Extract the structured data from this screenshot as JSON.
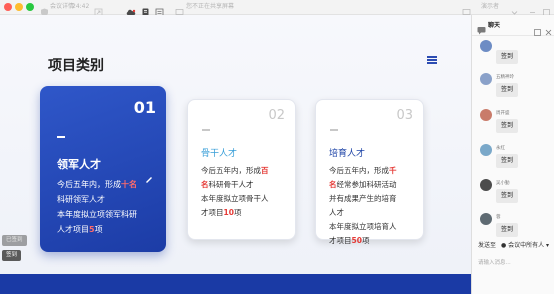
{
  "window": {
    "meeting_id": "会议详情",
    "timer": "24:42",
    "share_text": "您不正在共享屏幕",
    "top_right_text": "演示者",
    "colors": {
      "close": "#ff5f57",
      "minimize": "#febc2e",
      "maximize": "#28c840"
    }
  },
  "slide": {
    "title": "项目类别",
    "cards": [
      {
        "num": "01",
        "title": "领军人才",
        "body": [
          [
            {
              "t": "今后五年内，形成"
            },
            {
              "t": "十名",
              "red": true
            }
          ],
          [
            {
              "t": "科研领军人才"
            }
          ],
          [
            {
              "t": "本年度拟立项领军科研"
            }
          ],
          [
            {
              "t": "人才项目"
            },
            {
              "t": "5",
              "red": true
            },
            {
              "t": "项"
            }
          ]
        ]
      },
      {
        "num": "02",
        "title": "骨干人才",
        "body": [
          [
            {
              "t": "今后五年内，形成"
            },
            {
              "t": "百",
              "red": true
            }
          ],
          [
            {
              "t": "名",
              "red": true
            },
            {
              "t": "科研骨干人才"
            }
          ],
          [
            {
              "t": "本年度拟立项骨干人"
            }
          ],
          [
            {
              "t": "才项目"
            },
            {
              "t": "10",
              "red": true
            },
            {
              "t": "项"
            }
          ]
        ]
      },
      {
        "num": "03",
        "title": "培育人才",
        "body": [
          [
            {
              "t": "今后五年内，形成"
            },
            {
              "t": "千",
              "red": true
            }
          ],
          [
            {
              "t": "名",
              "red": true
            },
            {
              "t": "经常参加科研活动"
            }
          ],
          [
            {
              "t": "并有成果产生的培育"
            }
          ],
          [
            {
              "t": "人才"
            }
          ],
          [
            {
              "t": "本年度拟立项培育人"
            }
          ],
          [
            {
              "t": "才项目"
            },
            {
              "t": "50",
              "red": true
            },
            {
              "t": "项"
            }
          ]
        ]
      }
    ],
    "pill_top": "已签到",
    "pill_bottom": "签到",
    "accent": "#1a3aa5"
  },
  "chat": {
    "title": "聊天",
    "messages": [
      {
        "name": "",
        "text": "签到",
        "avatar_color": "#6d8cc4"
      },
      {
        "name": "五精神玲",
        "text": "签到",
        "avatar_color": "#8aa1c9"
      },
      {
        "name": "周开盛",
        "text": "签到",
        "avatar_color": "#c97b6a"
      },
      {
        "name": "永红",
        "text": "签到",
        "avatar_color": "#7aa8c9"
      },
      {
        "name": "吴小勤",
        "text": "签到",
        "avatar_color": "#4c4c4c"
      },
      {
        "name": "蓉",
        "text": "签到",
        "avatar_color": "#5e6a72"
      }
    ],
    "send_to_label": "发送至",
    "send_to_target": "会议中所有人",
    "input_placeholder": "请输入消息..."
  }
}
